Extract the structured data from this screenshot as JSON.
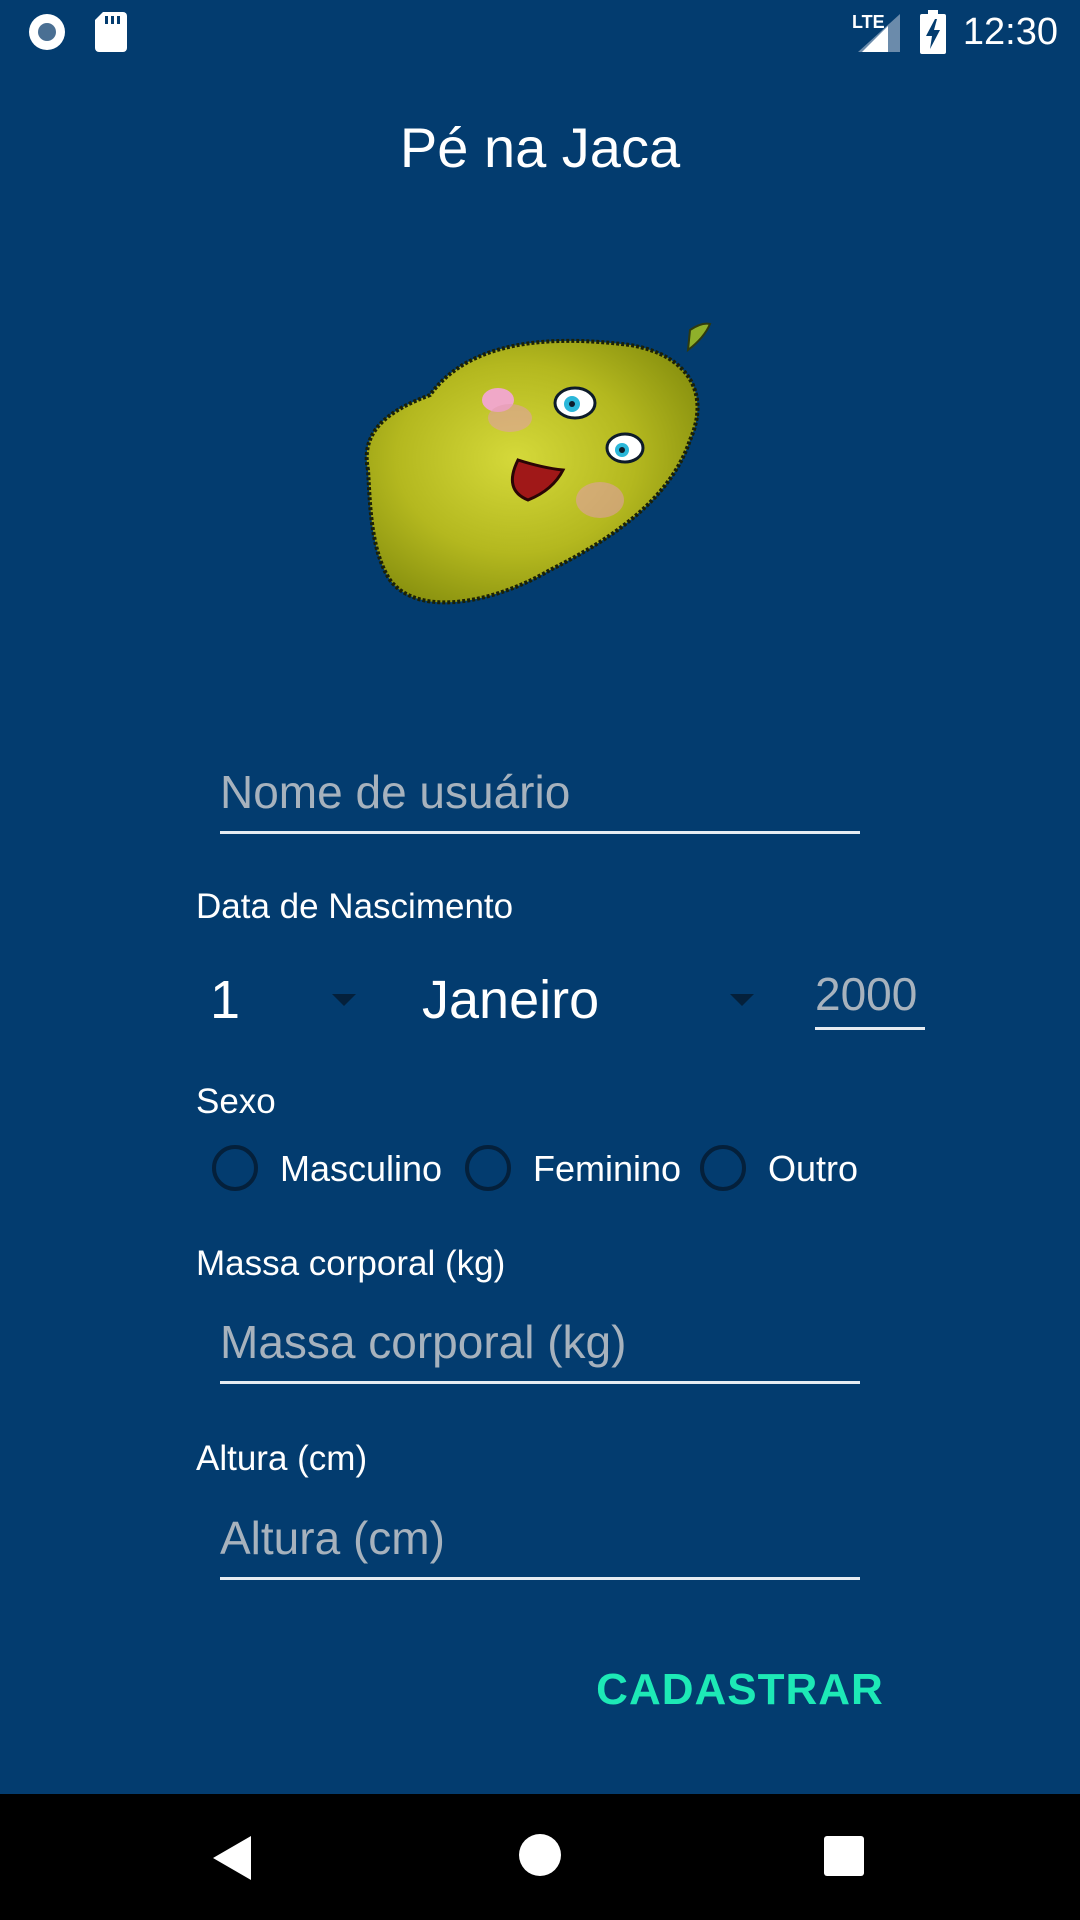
{
  "status_bar": {
    "time": "12:30",
    "network": "LTE",
    "icons": [
      "record-icon",
      "sd-card-icon",
      "signal-icon",
      "battery-charging-icon"
    ]
  },
  "app": {
    "title": "Pé na Jaca",
    "mascot": "jackfruit-mascot"
  },
  "form": {
    "username": {
      "placeholder": "Nome de usuário",
      "value": ""
    },
    "birthdate": {
      "label": "Data de Nascimento",
      "day": "1",
      "month": "Janeiro",
      "year_placeholder": "2000"
    },
    "sex": {
      "label": "Sexo",
      "options": [
        "Masculino",
        "Feminino",
        "Outro"
      ],
      "selected": null
    },
    "weight": {
      "label": "Massa corporal (kg)",
      "placeholder": "Massa corporal (kg)",
      "value": ""
    },
    "height": {
      "label": "Altura (cm)",
      "placeholder": "Altura (cm)",
      "value": ""
    },
    "submit_label": "CADASTRAR"
  },
  "colors": {
    "background": "#033c6f",
    "accent": "#1de9b6",
    "nav_bar": "#000000"
  },
  "nav": {
    "icons": [
      "back-icon",
      "home-icon",
      "recents-icon"
    ]
  }
}
